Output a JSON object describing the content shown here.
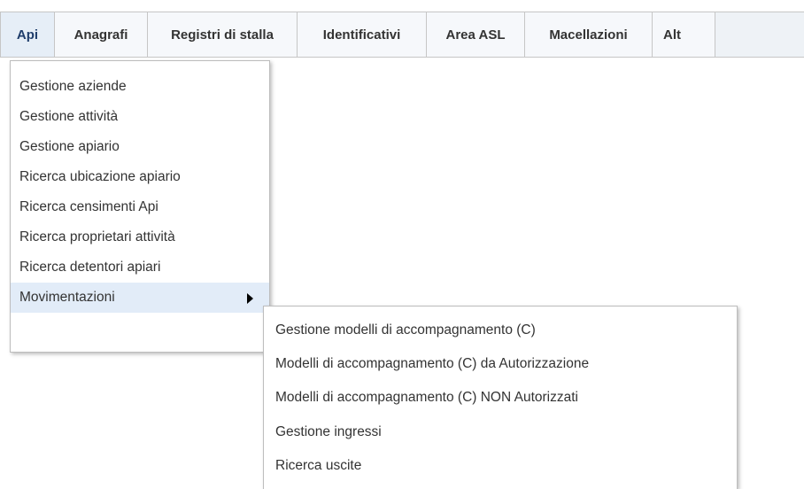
{
  "menubar": {
    "tabs": [
      {
        "label": "Api"
      },
      {
        "label": "Anagrafi"
      },
      {
        "label": "Registri di stalla"
      },
      {
        "label": "Identificativi"
      },
      {
        "label": "Area ASL"
      },
      {
        "label": "Macellazioni"
      },
      {
        "label": "Alt"
      }
    ]
  },
  "dropdown": {
    "items": [
      {
        "label": "Gestione aziende"
      },
      {
        "label": "Gestione attività"
      },
      {
        "label": "Gestione apiario"
      },
      {
        "label": "Ricerca ubicazione apiario"
      },
      {
        "label": "Ricerca censimenti Api"
      },
      {
        "label": "Ricerca proprietari attività"
      },
      {
        "label": "Ricerca detentori apiari"
      },
      {
        "label": "Movimentazioni"
      }
    ]
  },
  "submenu": {
    "items": [
      {
        "label": "Gestione modelli di accompagnamento (C)"
      },
      {
        "label": "Modelli di accompagnamento (C) da Autorizzazione"
      },
      {
        "label": "Modelli di accompagnamento (C) NON Autorizzati"
      },
      {
        "label": "Gestione ingressi"
      },
      {
        "label": "Ricerca uscite"
      }
    ]
  }
}
